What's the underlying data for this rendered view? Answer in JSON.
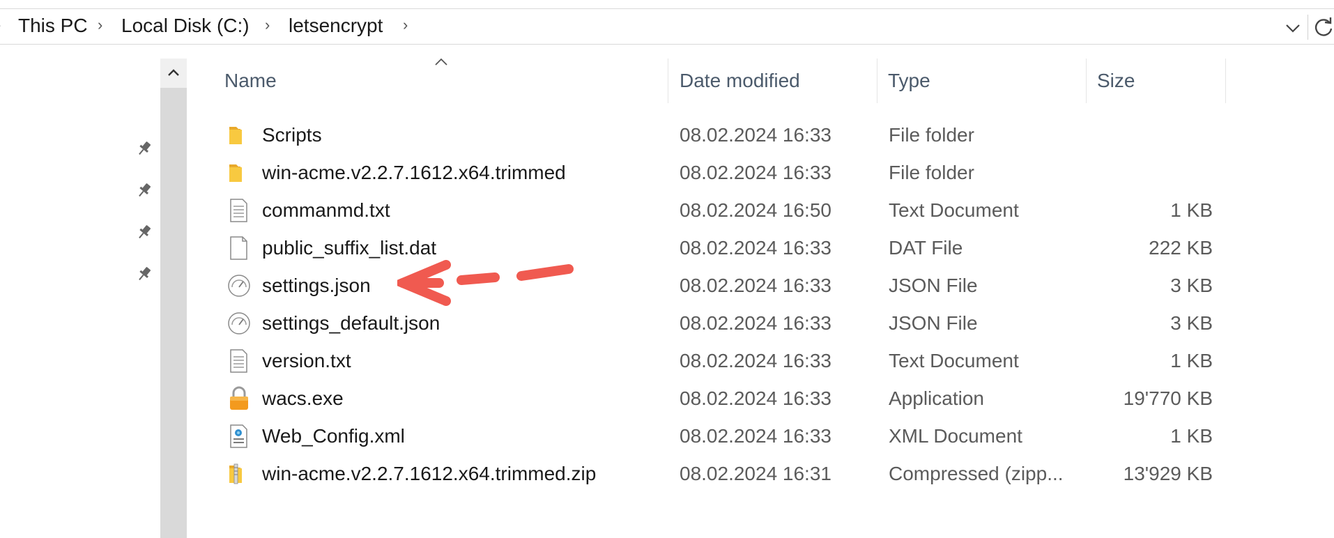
{
  "breadcrumb": [
    "This PC",
    "Local Disk (C:)",
    "letsencrypt"
  ],
  "columns": {
    "name": "Name",
    "date": "Date modified",
    "type": "Type",
    "size": "Size"
  },
  "files": [
    {
      "name": "Scripts",
      "date": "08.02.2024 16:33",
      "type": "File folder",
      "size": "",
      "icon": "folder-icon"
    },
    {
      "name": "win-acme.v2.2.7.1612.x64.trimmed",
      "date": "08.02.2024 16:33",
      "type": "File folder",
      "size": "",
      "icon": "folder-icon"
    },
    {
      "name": "commanmd.txt",
      "date": "08.02.2024 16:50",
      "type": "Text Document",
      "size": "1 KB",
      "icon": "text-document-icon"
    },
    {
      "name": "public_suffix_list.dat",
      "date": "08.02.2024 16:33",
      "type": "DAT File",
      "size": "222 KB",
      "icon": "blank-file-icon"
    },
    {
      "name": "settings.json",
      "date": "08.02.2024 16:33",
      "type": "JSON File",
      "size": "3 KB",
      "icon": "json-file-icon"
    },
    {
      "name": "settings_default.json",
      "date": "08.02.2024 16:33",
      "type": "JSON File",
      "size": "3 KB",
      "icon": "json-file-icon"
    },
    {
      "name": "version.txt",
      "date": "08.02.2024 16:33",
      "type": "Text Document",
      "size": "1 KB",
      "icon": "text-document-icon"
    },
    {
      "name": "wacs.exe",
      "date": "08.02.2024 16:33",
      "type": "Application",
      "size": "19'770 KB",
      "icon": "lock-icon"
    },
    {
      "name": "Web_Config.xml",
      "date": "08.02.2024 16:33",
      "type": "XML Document",
      "size": "1 KB",
      "icon": "xml-document-icon"
    },
    {
      "name": "win-acme.v2.2.7.1612.x64.trimmed.zip",
      "date": "08.02.2024 16:31",
      "type": "Compressed (zipp...",
      "size": "13'929 KB",
      "icon": "zip-folder-icon"
    }
  ],
  "colors": {
    "annotation_arrow": "#f05a50",
    "folder": "#f8c940",
    "header_text": "#4b5a6b",
    "scrollbar": "#d9d9d9"
  }
}
